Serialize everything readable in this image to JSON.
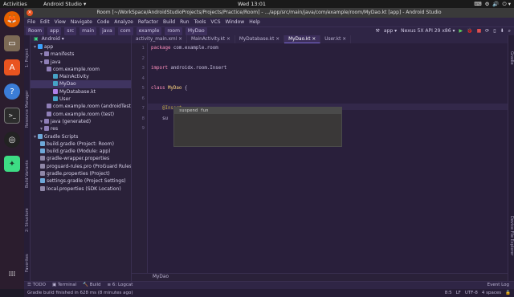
{
  "topbar": {
    "activities": "Activities",
    "app_name": "Android Studio ▾",
    "clock": "Wed 13:01",
    "tray": [
      "⌨",
      "⚙",
      "🔊",
      "⏻ ▾"
    ]
  },
  "dock": [
    "firefox-icon",
    "files-icon",
    "software-icon",
    "help-icon",
    "terminal-icon",
    "obs-icon",
    "android-studio-icon",
    "apps-icon"
  ],
  "window": {
    "title": "Room [~/WorkSpace/AndroidStudioProjects/Projects/Practice/Room] - .../app/src/main/java/com/example/room/MyDao.kt [app] - Android Studio"
  },
  "menu": [
    "File",
    "Edit",
    "View",
    "Navigate",
    "Code",
    "Analyze",
    "Refactor",
    "Build",
    "Run",
    "Tools",
    "VCS",
    "Window",
    "Help"
  ],
  "nav": {
    "crumbs": [
      "Room",
      "app",
      "src",
      "main",
      "java",
      "com",
      "example",
      "room",
      "MyDao"
    ],
    "config": "app ▾",
    "device": "Nexus 5X API 29 x86 ▾"
  },
  "left_strip": [
    "1: Project",
    "Resource Manager",
    "Build Variants",
    "2: Structure",
    "Favorites"
  ],
  "right_strip": [
    "Gradle",
    "Device File Explorer"
  ],
  "project": {
    "view": "Android ▾",
    "tree": [
      {
        "label": "app",
        "indent": 0,
        "color": "#3ba2ff"
      },
      {
        "label": "manifests",
        "indent": 1,
        "color": "#8f7fb8"
      },
      {
        "label": "java",
        "indent": 1,
        "color": "#8f7fb8"
      },
      {
        "label": "com.example.room",
        "indent": 2,
        "color": "#8f7fb8"
      },
      {
        "label": "MainActivity",
        "indent": 3,
        "color": "#46a3c7"
      },
      {
        "label": "MyDao",
        "indent": 3,
        "color": "#46a3c7",
        "selected": true
      },
      {
        "label": "MyDatabase.kt",
        "indent": 3,
        "color": "#b080e8"
      },
      {
        "label": "User",
        "indent": 3,
        "color": "#46a3c7"
      },
      {
        "label": "com.example.room (androidTest)",
        "indent": 2,
        "color": "#8f7fb8"
      },
      {
        "label": "com.example.room (test)",
        "indent": 2,
        "color": "#8f7fb8"
      },
      {
        "label": "java (generated)",
        "indent": 1,
        "color": "#8f7fb8"
      },
      {
        "label": "res",
        "indent": 1,
        "color": "#8f7fb8"
      },
      {
        "label": "Gradle Scripts",
        "indent": 0,
        "color": "#6ea8d8"
      },
      {
        "label": "build.gradle (Project: Room)",
        "indent": 1,
        "color": "#6ea8d8"
      },
      {
        "label": "build.gradle (Module: app)",
        "indent": 1,
        "color": "#6ea8d8"
      },
      {
        "label": "gradle-wrapper.properties",
        "indent": 1,
        "color": "#8f87a8"
      },
      {
        "label": "proguard-rules.pro (ProGuard Rules)",
        "indent": 1,
        "color": "#8f87a8"
      },
      {
        "label": "gradle.properties (Project)",
        "indent": 1,
        "color": "#8f87a8"
      },
      {
        "label": "settings.gradle (Project Settings)",
        "indent": 1,
        "color": "#6ea8d8"
      },
      {
        "label": "local.properties (SDK Location)",
        "indent": 1,
        "color": "#8f87a8"
      }
    ]
  },
  "editor": {
    "tabs": [
      {
        "label": "activity_main.xml ×",
        "active": false
      },
      {
        "label": "MainActivity.kt ×",
        "active": false
      },
      {
        "label": "MyDatabase.kt ×",
        "active": false
      },
      {
        "label": "MyDao.kt ×",
        "active": true
      },
      {
        "label": "User.kt ×",
        "active": false
      }
    ],
    "lines": [
      "1",
      "2",
      "3",
      "4",
      "5",
      "6",
      "7",
      "8",
      "9"
    ],
    "code": {
      "l1_kw": "package",
      "l1_rest": " com.example.room",
      "l3_kw": "import",
      "l3_rest": " androidx.room.Insert",
      "l5_kw": "class",
      "l5_name": " MyDao",
      "l5_rest": " {",
      "l7": "    @Insert",
      "l8": "    su"
    },
    "completion": "suspend fun",
    "breadcrumb": "MyDao"
  },
  "bottom_tabs": [
    "☰ TODO",
    "▣ Terminal",
    "🔨 Build",
    "≡ 6: Logcat"
  ],
  "status": {
    "message": "Gradle build finished in 628 ms (8 minutes ago)",
    "right": [
      "8:5",
      "LF",
      "UTF-8",
      "4 spaces"
    ],
    "event_log": "Event Log"
  }
}
